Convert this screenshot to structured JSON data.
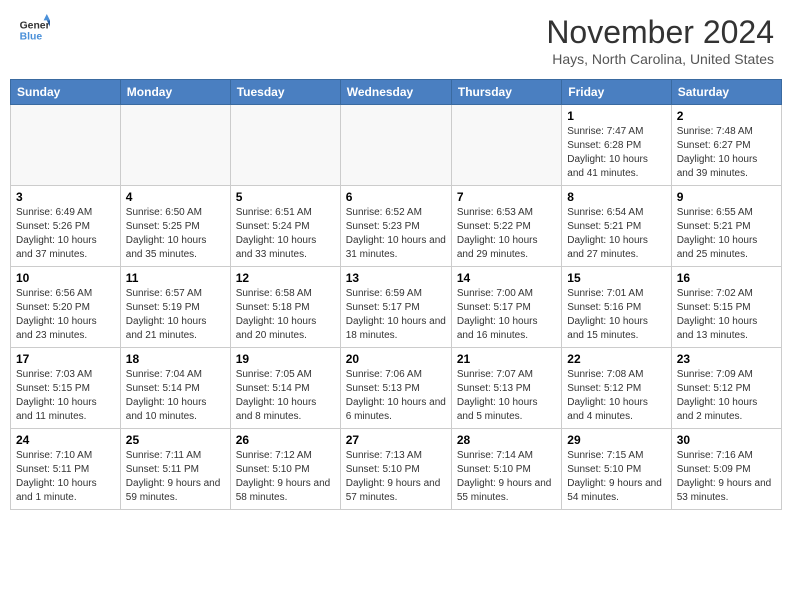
{
  "header": {
    "logo_line1": "General",
    "logo_line2": "Blue",
    "month": "November 2024",
    "location": "Hays, North Carolina, United States"
  },
  "weekdays": [
    "Sunday",
    "Monday",
    "Tuesday",
    "Wednesday",
    "Thursday",
    "Friday",
    "Saturday"
  ],
  "weeks": [
    [
      {
        "day": "",
        "info": ""
      },
      {
        "day": "",
        "info": ""
      },
      {
        "day": "",
        "info": ""
      },
      {
        "day": "",
        "info": ""
      },
      {
        "day": "",
        "info": ""
      },
      {
        "day": "1",
        "info": "Sunrise: 7:47 AM\nSunset: 6:28 PM\nDaylight: 10 hours and 41 minutes."
      },
      {
        "day": "2",
        "info": "Sunrise: 7:48 AM\nSunset: 6:27 PM\nDaylight: 10 hours and 39 minutes."
      }
    ],
    [
      {
        "day": "3",
        "info": "Sunrise: 6:49 AM\nSunset: 5:26 PM\nDaylight: 10 hours and 37 minutes."
      },
      {
        "day": "4",
        "info": "Sunrise: 6:50 AM\nSunset: 5:25 PM\nDaylight: 10 hours and 35 minutes."
      },
      {
        "day": "5",
        "info": "Sunrise: 6:51 AM\nSunset: 5:24 PM\nDaylight: 10 hours and 33 minutes."
      },
      {
        "day": "6",
        "info": "Sunrise: 6:52 AM\nSunset: 5:23 PM\nDaylight: 10 hours and 31 minutes."
      },
      {
        "day": "7",
        "info": "Sunrise: 6:53 AM\nSunset: 5:22 PM\nDaylight: 10 hours and 29 minutes."
      },
      {
        "day": "8",
        "info": "Sunrise: 6:54 AM\nSunset: 5:21 PM\nDaylight: 10 hours and 27 minutes."
      },
      {
        "day": "9",
        "info": "Sunrise: 6:55 AM\nSunset: 5:21 PM\nDaylight: 10 hours and 25 minutes."
      }
    ],
    [
      {
        "day": "10",
        "info": "Sunrise: 6:56 AM\nSunset: 5:20 PM\nDaylight: 10 hours and 23 minutes."
      },
      {
        "day": "11",
        "info": "Sunrise: 6:57 AM\nSunset: 5:19 PM\nDaylight: 10 hours and 21 minutes."
      },
      {
        "day": "12",
        "info": "Sunrise: 6:58 AM\nSunset: 5:18 PM\nDaylight: 10 hours and 20 minutes."
      },
      {
        "day": "13",
        "info": "Sunrise: 6:59 AM\nSunset: 5:17 PM\nDaylight: 10 hours and 18 minutes."
      },
      {
        "day": "14",
        "info": "Sunrise: 7:00 AM\nSunset: 5:17 PM\nDaylight: 10 hours and 16 minutes."
      },
      {
        "day": "15",
        "info": "Sunrise: 7:01 AM\nSunset: 5:16 PM\nDaylight: 10 hours and 15 minutes."
      },
      {
        "day": "16",
        "info": "Sunrise: 7:02 AM\nSunset: 5:15 PM\nDaylight: 10 hours and 13 minutes."
      }
    ],
    [
      {
        "day": "17",
        "info": "Sunrise: 7:03 AM\nSunset: 5:15 PM\nDaylight: 10 hours and 11 minutes."
      },
      {
        "day": "18",
        "info": "Sunrise: 7:04 AM\nSunset: 5:14 PM\nDaylight: 10 hours and 10 minutes."
      },
      {
        "day": "19",
        "info": "Sunrise: 7:05 AM\nSunset: 5:14 PM\nDaylight: 10 hours and 8 minutes."
      },
      {
        "day": "20",
        "info": "Sunrise: 7:06 AM\nSunset: 5:13 PM\nDaylight: 10 hours and 6 minutes."
      },
      {
        "day": "21",
        "info": "Sunrise: 7:07 AM\nSunset: 5:13 PM\nDaylight: 10 hours and 5 minutes."
      },
      {
        "day": "22",
        "info": "Sunrise: 7:08 AM\nSunset: 5:12 PM\nDaylight: 10 hours and 4 minutes."
      },
      {
        "day": "23",
        "info": "Sunrise: 7:09 AM\nSunset: 5:12 PM\nDaylight: 10 hours and 2 minutes."
      }
    ],
    [
      {
        "day": "24",
        "info": "Sunrise: 7:10 AM\nSunset: 5:11 PM\nDaylight: 10 hours and 1 minute."
      },
      {
        "day": "25",
        "info": "Sunrise: 7:11 AM\nSunset: 5:11 PM\nDaylight: 9 hours and 59 minutes."
      },
      {
        "day": "26",
        "info": "Sunrise: 7:12 AM\nSunset: 5:10 PM\nDaylight: 9 hours and 58 minutes."
      },
      {
        "day": "27",
        "info": "Sunrise: 7:13 AM\nSunset: 5:10 PM\nDaylight: 9 hours and 57 minutes."
      },
      {
        "day": "28",
        "info": "Sunrise: 7:14 AM\nSunset: 5:10 PM\nDaylight: 9 hours and 55 minutes."
      },
      {
        "day": "29",
        "info": "Sunrise: 7:15 AM\nSunset: 5:10 PM\nDaylight: 9 hours and 54 minutes."
      },
      {
        "day": "30",
        "info": "Sunrise: 7:16 AM\nSunset: 5:09 PM\nDaylight: 9 hours and 53 minutes."
      }
    ]
  ]
}
